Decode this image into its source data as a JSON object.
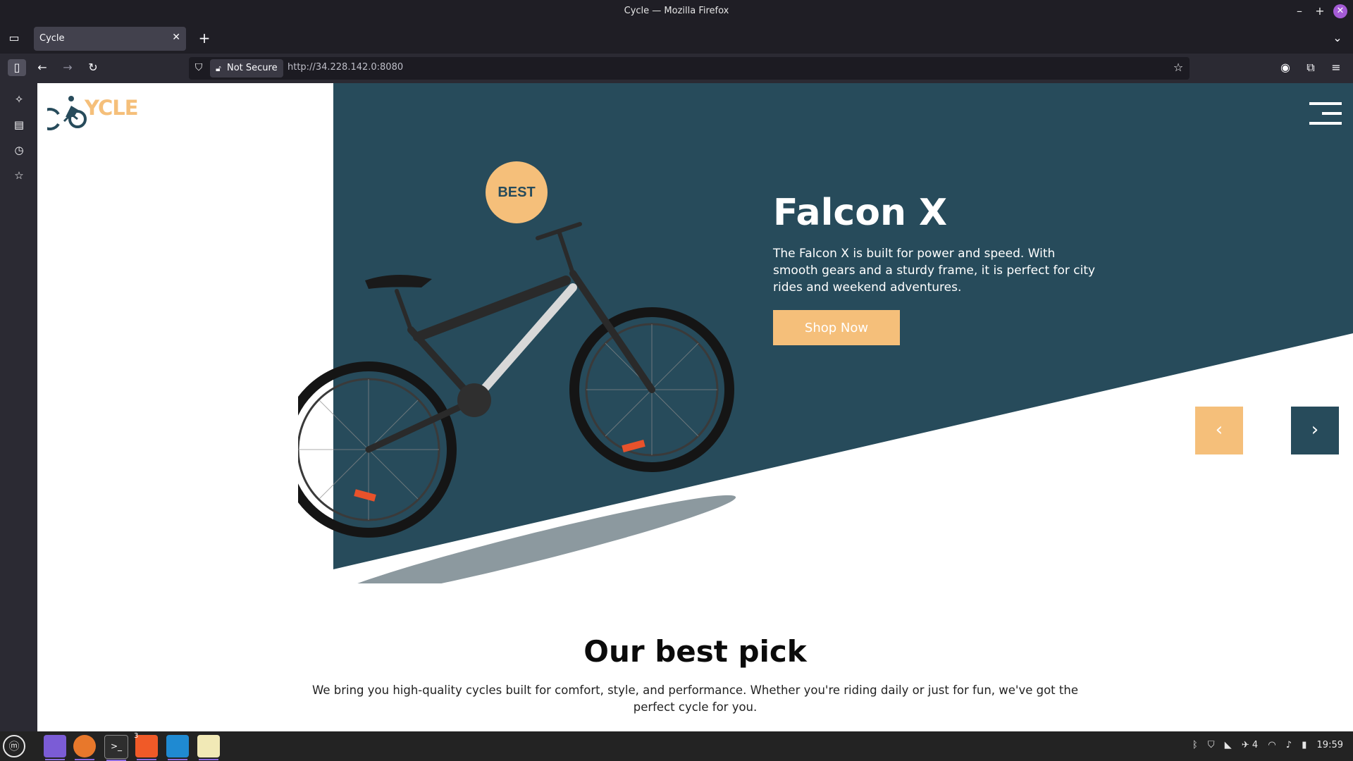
{
  "window": {
    "title": "Cycle — Mozilla Firefox"
  },
  "tabs": [
    {
      "label": "Cycle"
    }
  ],
  "navbar": {
    "security_label": "Not Secure",
    "url": "http://34.228.142.0:8080"
  },
  "site": {
    "logo_text": "YCLE",
    "badge": "BEST",
    "hero": {
      "title": "Falcon X",
      "description": "The Falcon X is built for power and speed. With smooth gears and a sturdy frame, it is perfect for city rides and weekend adventures.",
      "cta": "Shop Now"
    },
    "slider": {
      "prev": "‹",
      "next": "›"
    },
    "section": {
      "title": "Our best pick",
      "description": "We bring you high-quality cycles built for comfort, style, and performance. Whether you're riding daily or just for fun, we've got the perfect cycle for you."
    }
  },
  "taskbar": {
    "apps": [
      "menu",
      "files",
      "firefox",
      "terminal",
      "brave",
      "vscode",
      "text-editor"
    ],
    "brave_badge": "3",
    "tray_count": "4",
    "clock": "19:59"
  },
  "colors": {
    "hero_bg": "#274b5b",
    "accent": "#f5bf7a",
    "browser_bg": "#2b2a33"
  }
}
